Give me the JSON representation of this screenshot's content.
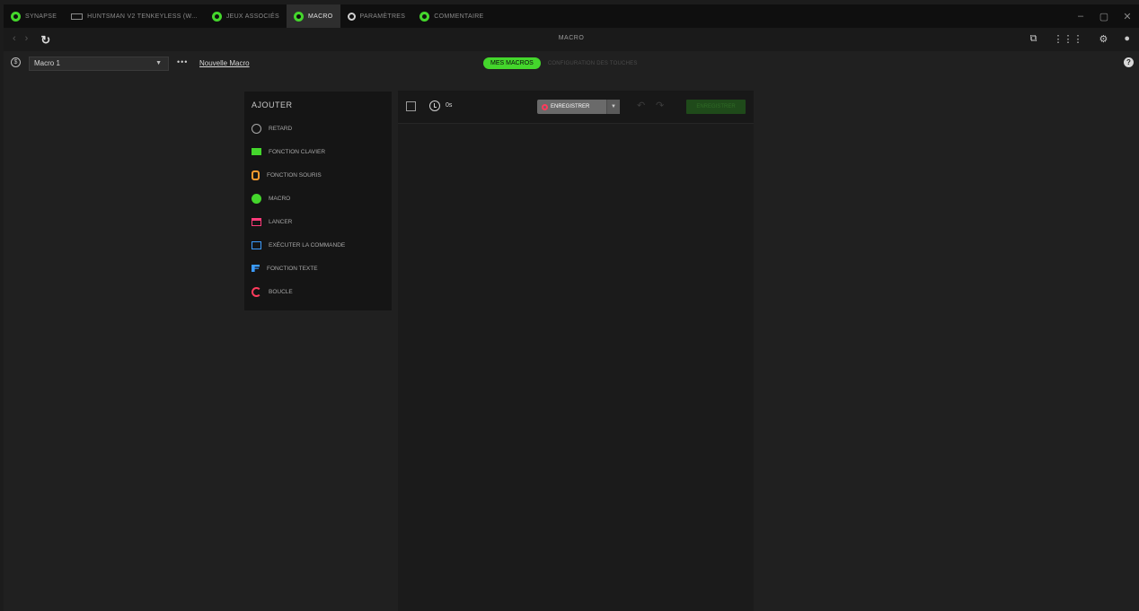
{
  "tabs": [
    {
      "label": "SYNAPSE",
      "icon": "razer-icon"
    },
    {
      "label": "HUNTSMAN V2 TENKEYLESS (W...",
      "icon": "keyboard-icon"
    },
    {
      "label": "JEUX ASSOCIÉS",
      "icon": "gamepad-icon"
    },
    {
      "label": "MACRO",
      "icon": "macro-icon",
      "active": true
    },
    {
      "label": "PARAMÈTRES",
      "icon": "gear-icon"
    },
    {
      "label": "COMMENTAIRE",
      "icon": "feedback-icon"
    }
  ],
  "window_controls": {
    "minimize": "–",
    "maximize": "▢",
    "close": "✕"
  },
  "nav": {
    "title": "MACRO",
    "back": "‹",
    "forward": "›",
    "refresh": "↻"
  },
  "macro_bar": {
    "selected_macro": "Macro 1",
    "more": "•••",
    "new_macro": "Nouvelle Macro",
    "tab_active": "MES MACROS",
    "tab_inactive": "CONFIGURATION DES TOUCHES"
  },
  "add_panel": {
    "title": "AJOUTER",
    "items": [
      {
        "label": "RETARD",
        "icon": "delay-icon"
      },
      {
        "label": "FONCTION CLAVIER",
        "icon": "keyboard-function-icon"
      },
      {
        "label": "FONCTION SOURIS",
        "icon": "mouse-function-icon"
      },
      {
        "label": "MACRO",
        "icon": "macro-icon"
      },
      {
        "label": "LANCER",
        "icon": "launch-icon"
      },
      {
        "label": "EXÉCUTER LA COMMANDE",
        "icon": "execute-command-icon"
      },
      {
        "label": "FONCTION TEXTE",
        "icon": "text-function-icon"
      },
      {
        "label": "BOUCLE",
        "icon": "loop-icon"
      }
    ]
  },
  "editor": {
    "duration": "0s",
    "record_label": "ENREGISTRER",
    "save_label": "ENREGISTRER"
  },
  "colors": {
    "accent": "#44d62c",
    "record": "#ff3b5c"
  }
}
